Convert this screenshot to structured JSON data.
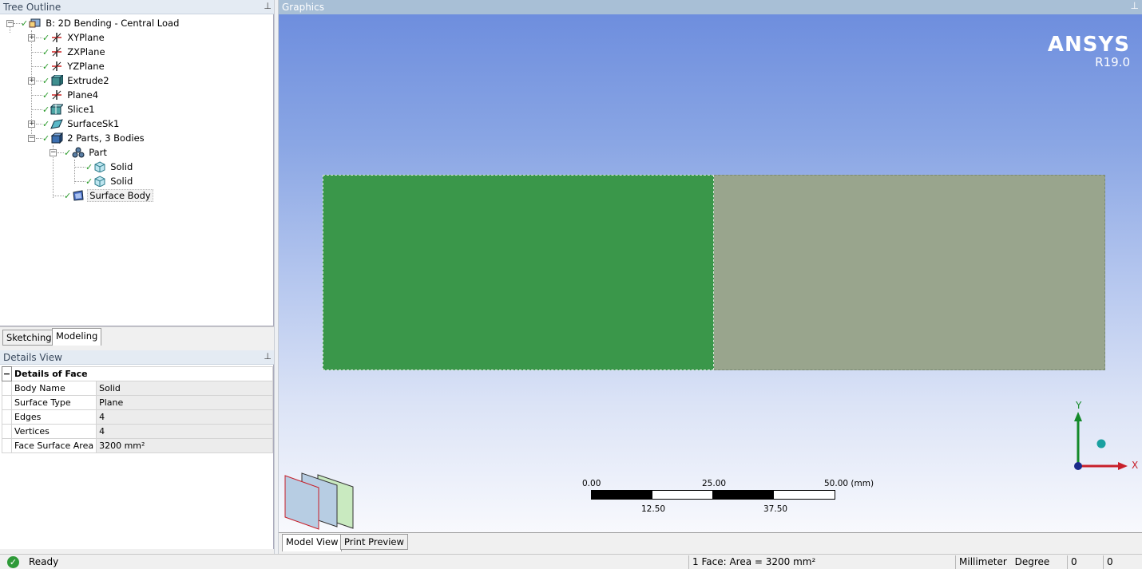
{
  "tree": {
    "title": "Tree Outline",
    "pin": "⊥",
    "items": [
      {
        "label": "B: 2D Bending - Central Load",
        "icon": "model-icon"
      },
      {
        "label": "XYPlane",
        "icon": "plane-icon"
      },
      {
        "label": "ZXPlane",
        "icon": "plane-icon"
      },
      {
        "label": "YZPlane",
        "icon": "plane-icon"
      },
      {
        "label": "Extrude2",
        "icon": "extrude-icon"
      },
      {
        "label": "Plane4",
        "icon": "plane-icon"
      },
      {
        "label": "Slice1",
        "icon": "slice-icon"
      },
      {
        "label": "SurfaceSk1",
        "icon": "surface-sketch-icon"
      },
      {
        "label": "2 Parts, 3 Bodies",
        "icon": "parts-icon"
      },
      {
        "label": "Part",
        "icon": "part-icon"
      },
      {
        "label": "Solid",
        "icon": "solid-body-icon"
      },
      {
        "label": "Solid",
        "icon": "solid-body-icon"
      },
      {
        "label": "Surface Body",
        "icon": "surface-body-icon"
      }
    ],
    "tabs": [
      "Sketching",
      "Modeling"
    ]
  },
  "details": {
    "title": "Details View",
    "pin": "⊥",
    "group": "Details of Face",
    "collapse": "−",
    "rows": [
      {
        "key": "Body Name",
        "value": "Solid"
      },
      {
        "key": "Surface Type",
        "value": "Plane"
      },
      {
        "key": "Edges",
        "value": "4"
      },
      {
        "key": "Vertices",
        "value": "4"
      },
      {
        "key": "Face Surface Area",
        "value": "3200 mm²"
      }
    ]
  },
  "graphics": {
    "title": "Graphics",
    "pin": "⊥",
    "logo_brand": "ANSYS",
    "logo_version": "R19.0",
    "colors": {
      "selected_face": "#3a974a",
      "other_face": "#99a58d"
    },
    "scale": {
      "top_labels": [
        "0.00",
        "25.00",
        "50.00 (mm)"
      ],
      "bottom_labels": [
        "12.50",
        "37.50"
      ]
    },
    "triad": {
      "x": "X",
      "y": "Y"
    },
    "tabs": [
      "Model View",
      "Print Preview"
    ]
  },
  "status": {
    "ready": "Ready",
    "selection": "1 Face: Area = 3200 mm²",
    "units_length": "Millimeter",
    "units_angle": "Degree",
    "field1": "0",
    "field2": "0"
  }
}
